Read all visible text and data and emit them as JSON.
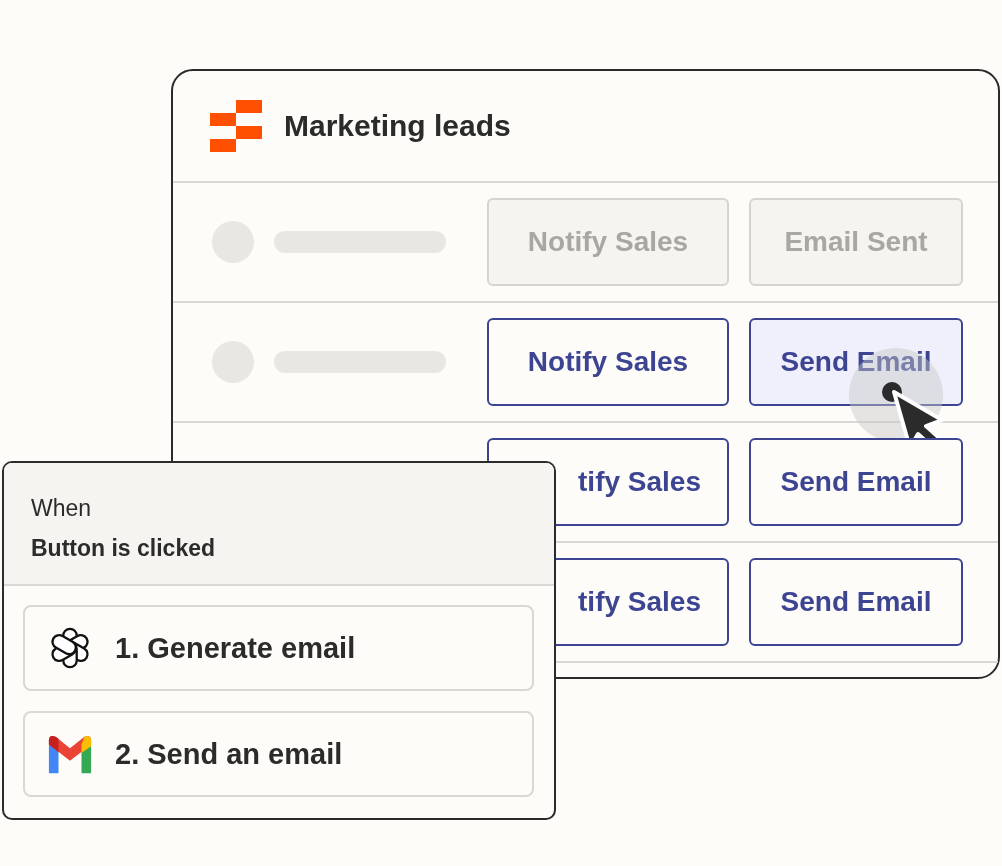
{
  "table": {
    "title": "Marketing leads",
    "rows": [
      {
        "covered": false,
        "buttons": [
          {
            "label": "Notify Sales",
            "disabled": true,
            "hovered": false
          },
          {
            "label": "Email Sent",
            "disabled": true,
            "hovered": false
          }
        ]
      },
      {
        "covered": false,
        "buttons": [
          {
            "label": "Notify Sales",
            "disabled": false,
            "hovered": false
          },
          {
            "label": "Send Email",
            "disabled": false,
            "hovered": true
          }
        ]
      },
      {
        "covered": true,
        "buttons": [
          {
            "label": "tify Sales",
            "disabled": false,
            "hovered": false
          },
          {
            "label": "Send Email",
            "disabled": false,
            "hovered": false
          }
        ]
      },
      {
        "covered": true,
        "buttons": [
          {
            "label": "tify Sales",
            "disabled": false,
            "hovered": false
          },
          {
            "label": "Send Email",
            "disabled": false,
            "hovered": false
          }
        ]
      }
    ]
  },
  "workflow": {
    "trigger_label": "When",
    "trigger": "Button is clicked",
    "steps": [
      {
        "kind": "ai",
        "label": "1. Generate email"
      },
      {
        "kind": "mail",
        "label": "2. Send an email"
      }
    ]
  }
}
